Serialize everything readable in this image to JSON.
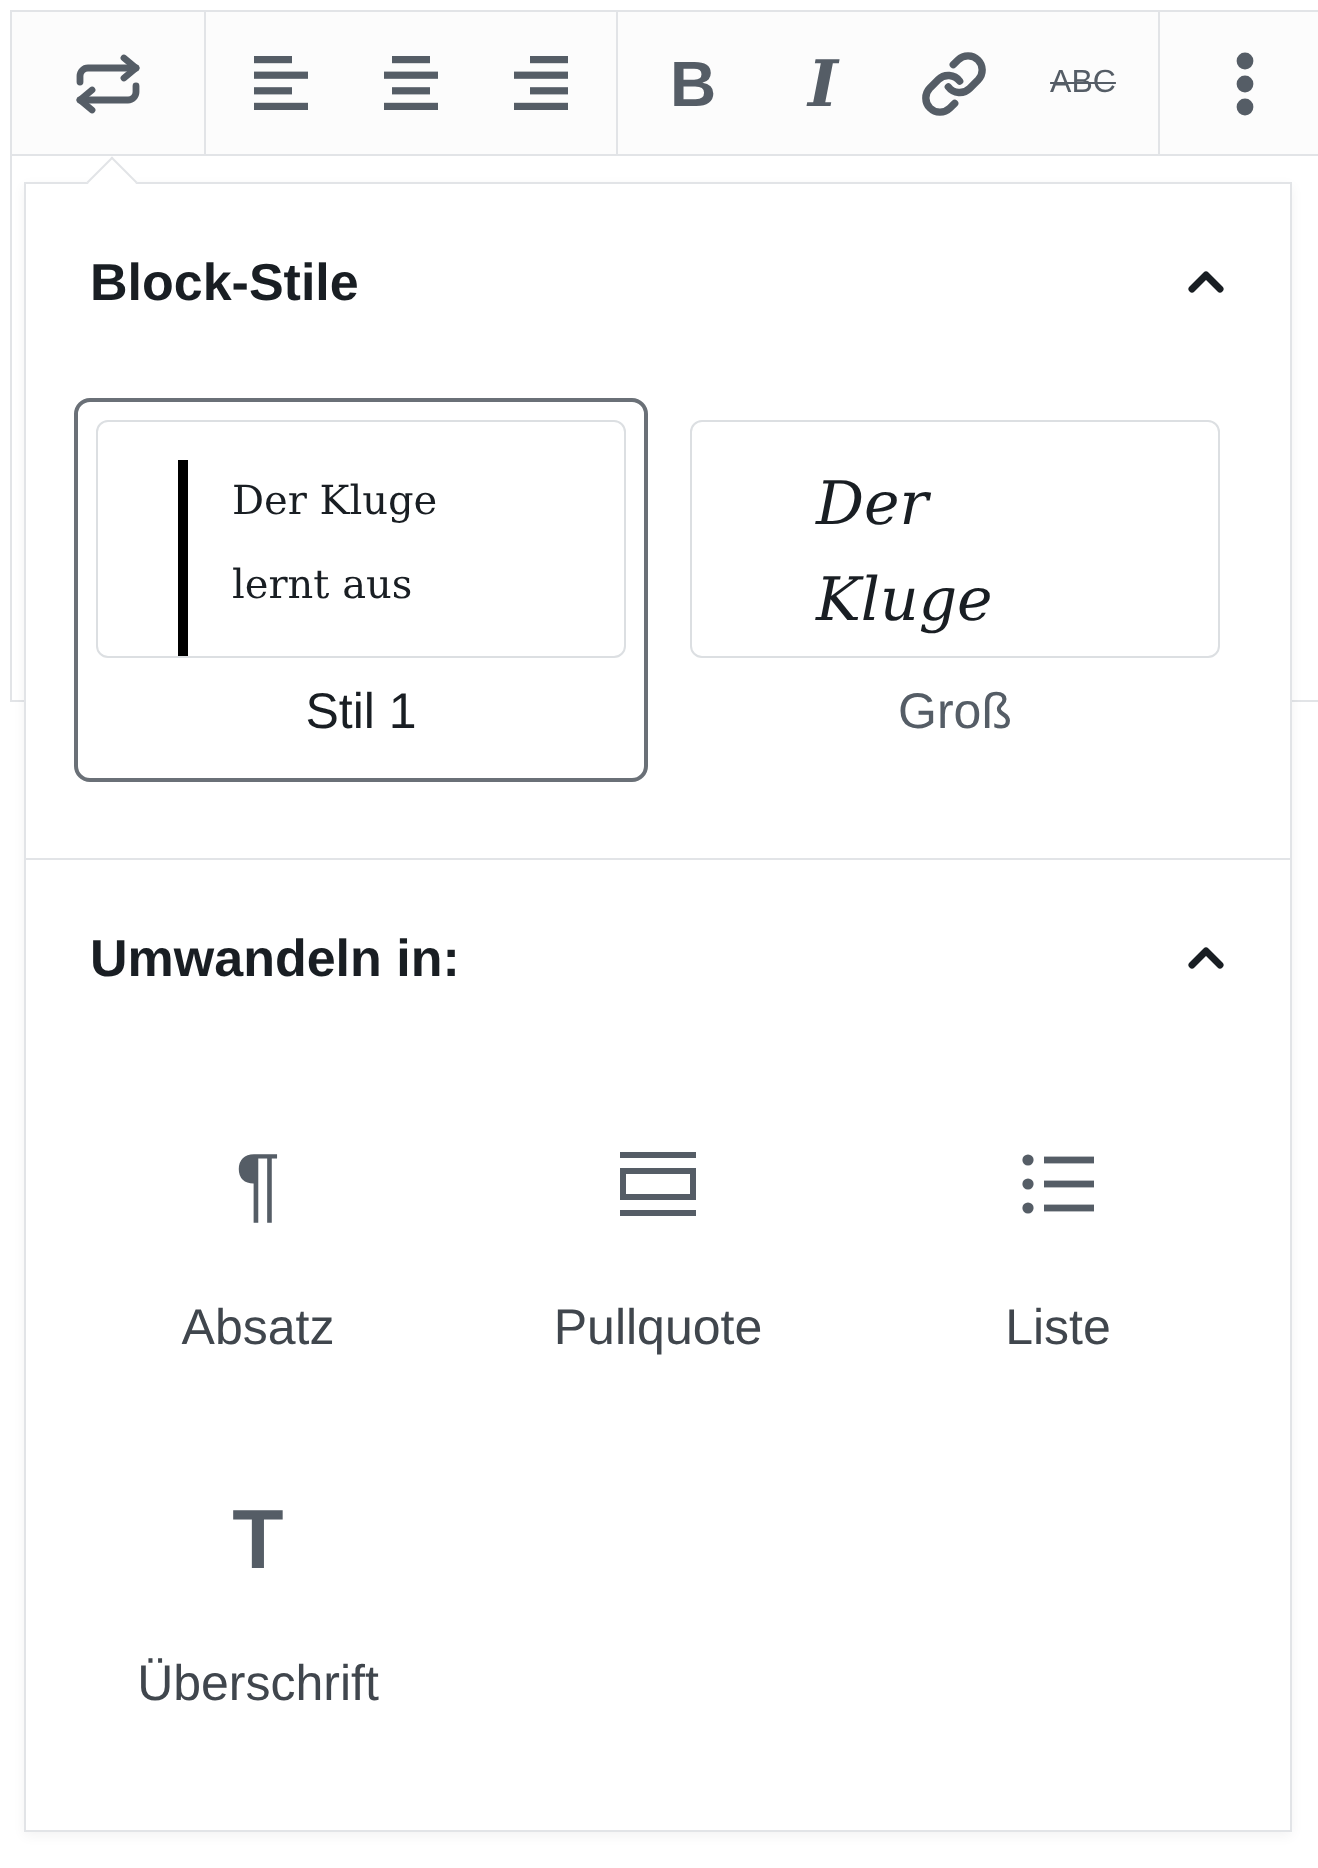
{
  "toolbar": {
    "groups": [
      {
        "buttons": [
          {
            "kind": "transform"
          }
        ]
      },
      {
        "buttons": [
          {
            "kind": "align-left"
          },
          {
            "kind": "align-center"
          },
          {
            "kind": "align-right"
          }
        ]
      },
      {
        "buttons": [
          {
            "kind": "bold",
            "glyph": "B"
          },
          {
            "kind": "italic",
            "glyph": "I"
          },
          {
            "kind": "link"
          },
          {
            "kind": "strikethrough",
            "glyph": "ABC"
          }
        ]
      },
      {
        "buttons": [
          {
            "kind": "more"
          }
        ]
      }
    ]
  },
  "popover": {
    "sections": [
      {
        "kind": "styles",
        "title": "Block-Stile",
        "expanded": true,
        "styles": [
          {
            "kind": "default",
            "label": "Stil 1",
            "selected": true,
            "preview": "Der Kluge lernt aus"
          },
          {
            "kind": "large",
            "label": "Groß",
            "selected": false,
            "preview": "Der Kluge"
          }
        ]
      },
      {
        "kind": "transforms",
        "title": "Umwandeln in:",
        "expanded": true,
        "items": [
          {
            "kind": "paragraph",
            "icon": "¶",
            "label": "Absatz"
          },
          {
            "kind": "pullquote",
            "label": "Pullquote"
          },
          {
            "kind": "list",
            "label": "Liste"
          },
          {
            "kind": "heading",
            "icon": "T",
            "label": "Überschrift"
          }
        ]
      }
    ]
  }
}
